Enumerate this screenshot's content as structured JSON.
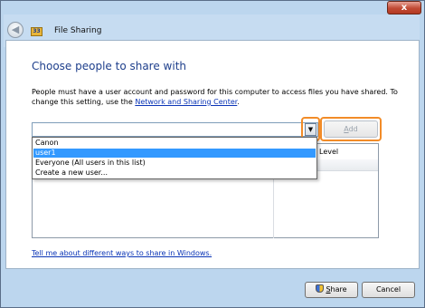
{
  "window": {
    "title": "File Sharing",
    "close_label": "x"
  },
  "content": {
    "heading": "Choose people to share with",
    "description_text": "People must have a user account and password for this computer to access files you have shared.  To change this setting, use the ",
    "description_link": "Network and Sharing Center",
    "description_end": "."
  },
  "picker": {
    "input_value": "",
    "add_label_prefix": "",
    "add_label_access": "A",
    "add_label_rest": "dd",
    "options": [
      "Canon",
      "user1",
      "Everyone (All users in this list)",
      "Create a new user..."
    ],
    "selected": "user1"
  },
  "permissions_table": {
    "column_header": "Level"
  },
  "help_link": "Tell me about different ways to share in Windows.",
  "buttons": {
    "share_access": "S",
    "share_rest": "hare",
    "cancel": "Cancel"
  },
  "icons": {
    "back": "back-arrow-icon",
    "app": "file-sharing-icon",
    "dropdown": "triangle-down-icon",
    "uac": "uac-shield-icon"
  },
  "colors": {
    "highlight": "#f28c28",
    "selection": "#3399ff",
    "link": "#0a34b6"
  }
}
